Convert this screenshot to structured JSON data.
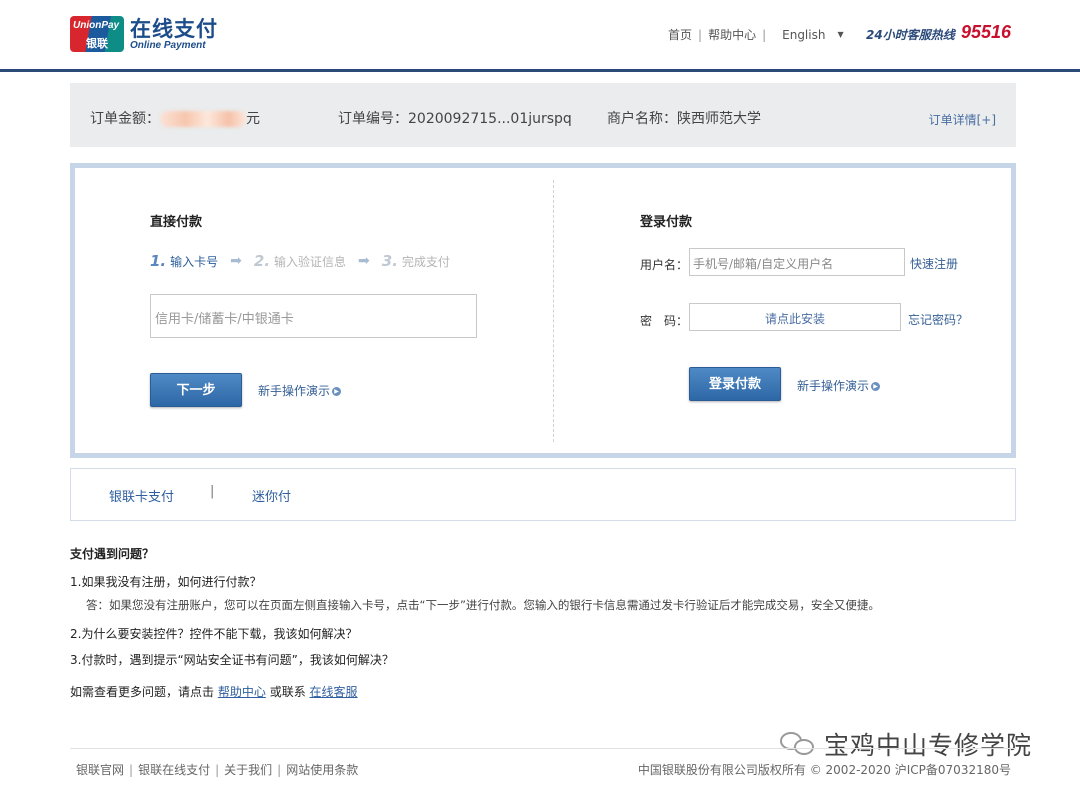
{
  "header": {
    "logo_badge_en": "UnionPay",
    "logo_badge_cn": "银联",
    "logo_title": "在线支付",
    "logo_subtitle": "Online Payment",
    "nav": [
      "首页",
      "帮助中心"
    ],
    "language": "English",
    "hotline_label": "24小时客服热线",
    "hotline_number": "95516"
  },
  "order": {
    "amount_label": "订单金额：",
    "amount_unit": "元",
    "number_label": "订单编号：",
    "number_value": "2020092715...01jurspq",
    "merchant_label": "商户名称：",
    "merchant_value": "陕西师范大学",
    "detail_link": "订单详情[+]"
  },
  "direct_pay": {
    "title": "直接付款",
    "steps": [
      {
        "num": "1.",
        "label": "输入卡号"
      },
      {
        "num": "2.",
        "label": "输入验证信息"
      },
      {
        "num": "3.",
        "label": "完成支付"
      }
    ],
    "card_placeholder": "信用卡/储蓄卡/中银通卡",
    "next_button": "下一步",
    "demo_link": "新手操作演示"
  },
  "login_pay": {
    "title": "登录付款",
    "username_label": "用户名：",
    "username_placeholder": "手机号/邮箱/自定义用户名",
    "register_link": "快速注册",
    "password_label": "密　码：",
    "password_install": "请点此安装",
    "forgot_link": "忘记密码？",
    "login_button": "登录付款",
    "demo_link": "新手操作演示"
  },
  "tabs": [
    "银联卡支付",
    "迷你付"
  ],
  "faq": {
    "title": "支付遇到问题？",
    "q1": "1.如果我没有注册，如何进行付款？",
    "a1": "答：如果您没有注册账户，您可以在页面左侧直接输入卡号，点击“下一步”进行付款。您输入的银行卡信息需通过发卡行验证后才能完成交易，安全又便捷。",
    "q2": "2.为什么要安装控件？控件不能下载，我该如何解决？",
    "q3": "3.付款时，遇到提示“网站安全证书有问题”，我该如何解决？",
    "more_prefix": "如需查看更多问题，请点击",
    "help_link": "帮助中心",
    "more_mid": "或联系",
    "service_link": "在线客服"
  },
  "footer": {
    "links": [
      "银联官网",
      "银联在线支付",
      "关于我们",
      "网站使用条款"
    ],
    "copyright": "中国银联股份有限公司版权所有 © 2002-2020 沪ICP备07032180号"
  },
  "watermark": "宝鸡中山专修学院",
  "colors": {
    "brand_blue": "#2b4a7a",
    "hotline_red": "#c8102e",
    "button_blue": "#2d67a6"
  }
}
